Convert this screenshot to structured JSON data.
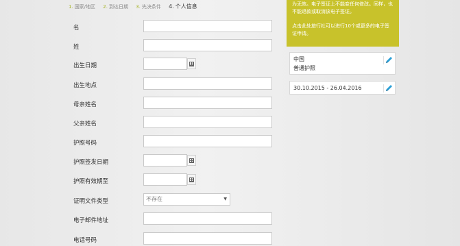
{
  "steps": [
    {
      "num": "1.",
      "label": "国家/地区",
      "active": false
    },
    {
      "num": "2.",
      "label": "到达日期",
      "active": false
    },
    {
      "num": "3.",
      "label": "先决条件",
      "active": false
    },
    {
      "num": "4.",
      "label": "个人信息",
      "active": true
    }
  ],
  "form": {
    "first_name_label": "名",
    "last_name_label": "姓",
    "birth_date_label": "出生日期",
    "birth_place_label": "出生地点",
    "mother_name_label": "母亲姓名",
    "father_name_label": "父亲姓名",
    "passport_number_label": "护照号码",
    "passport_issue_label": "护照签发日期",
    "passport_expiry_label": "护照有效期至",
    "doc_type_label": "证明文件类型",
    "doc_type_value": "不存在",
    "email_label": "电子邮件地址",
    "phone_label": "电话号码"
  },
  "notice": {
    "para1": "为无效。电子签证上不能变任何修改。同样，也不能退款或取消该电子签证。",
    "para2": "点击此处旅行社可以进行10个或更多的电子签证申请。"
  },
  "summary": {
    "country": "中国",
    "passport_type": "普通护照",
    "date_range": "30.10.2015 - 26.04.2016"
  },
  "colors": {
    "accent": "#c8c22b",
    "pencil": "#2a9fd6"
  }
}
